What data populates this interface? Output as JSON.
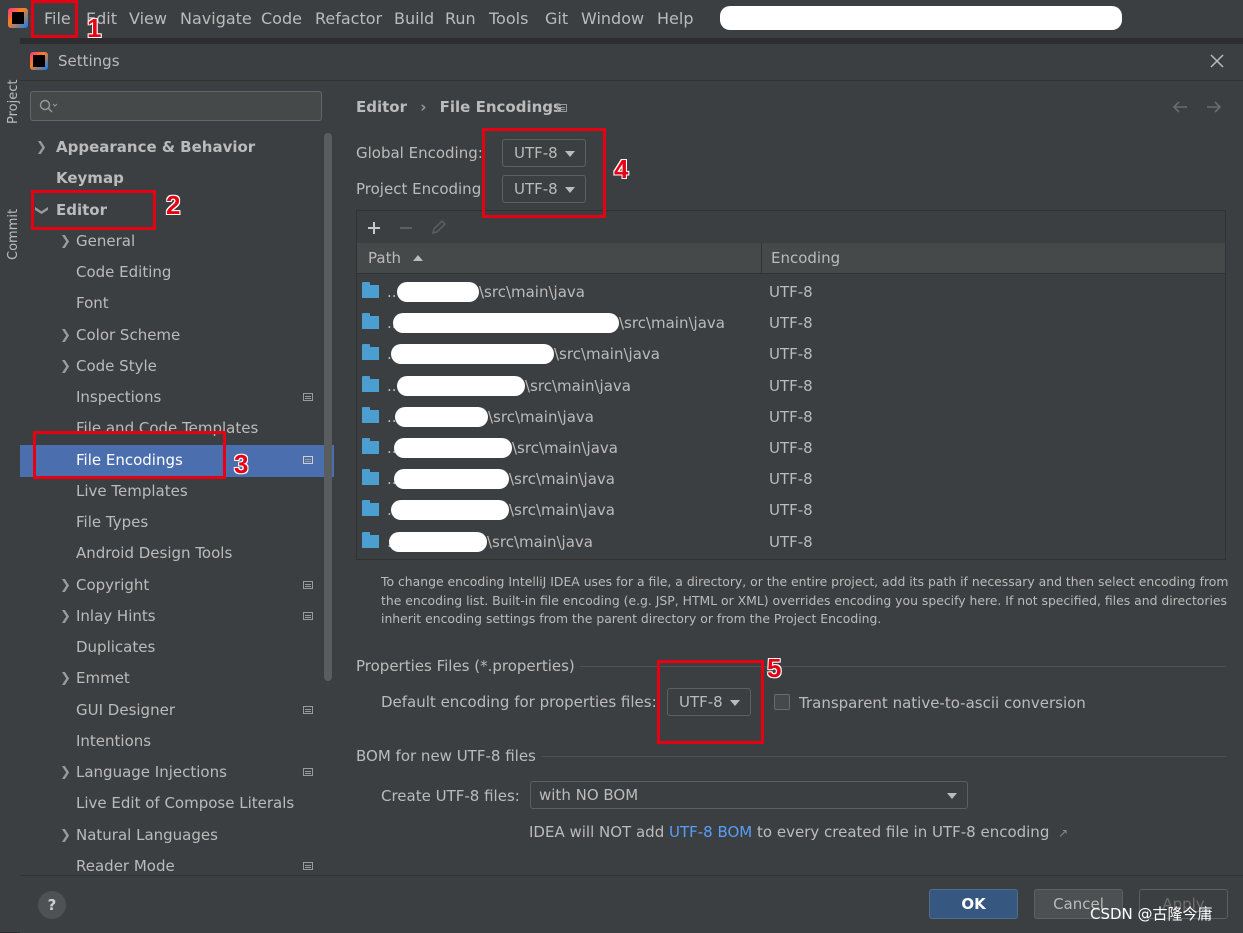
{
  "menubar": {
    "items": [
      "File",
      "Edit",
      "View",
      "Navigate",
      "Code",
      "Refactor",
      "Build",
      "Run",
      "Tools",
      "Git",
      "Window",
      "Help"
    ]
  },
  "toolstrip": {
    "project": "Project",
    "commit": "Commit"
  },
  "dialog": {
    "title": "Settings"
  },
  "sidebar": {
    "items": [
      {
        "label": "Appearance & Behavior"
      },
      {
        "label": "Keymap"
      },
      {
        "label": "Editor"
      },
      {
        "label": "General"
      },
      {
        "label": "Code Editing"
      },
      {
        "label": "Font"
      },
      {
        "label": "Color Scheme"
      },
      {
        "label": "Code Style"
      },
      {
        "label": "Inspections"
      },
      {
        "label": "File and Code Templates"
      },
      {
        "label": "File Encodings"
      },
      {
        "label": "Live Templates"
      },
      {
        "label": "File Types"
      },
      {
        "label": "Android Design Tools"
      },
      {
        "label": "Copyright"
      },
      {
        "label": "Inlay Hints"
      },
      {
        "label": "Duplicates"
      },
      {
        "label": "Emmet"
      },
      {
        "label": "GUI Designer"
      },
      {
        "label": "Intentions"
      },
      {
        "label": "Language Injections"
      },
      {
        "label": "Live Edit of Compose Literals"
      },
      {
        "label": "Natural Languages"
      },
      {
        "label": "Reader Mode"
      }
    ]
  },
  "breadcrumb": {
    "parent": "Editor",
    "sep": "›",
    "current": "File Encodings"
  },
  "encoding": {
    "global_label": "Global Encoding:",
    "global_value": "UTF-8",
    "project_label": "Project Encoding:",
    "project_value": "UTF-8"
  },
  "table": {
    "columns": [
      "Path",
      "Encoding"
    ],
    "rows": [
      {
        "prefix": "..",
        "suffix": "\\src\\main\\java",
        "encoding": "UTF-8"
      },
      {
        "prefix": "..",
        "suffix": "\\src\\main\\java",
        "encoding": "UTF-8"
      },
      {
        "prefix": "..",
        "suffix": "\\src\\main\\java",
        "encoding": "UTF-8"
      },
      {
        "prefix": "..",
        "suffix": "\\src\\main\\java",
        "encoding": "UTF-8"
      },
      {
        "prefix": "..",
        "suffix": "\\src\\main\\java",
        "encoding": "UTF-8"
      },
      {
        "prefix": "..",
        "suffix": "\\src\\main\\java",
        "encoding": "UTF-8"
      },
      {
        "prefix": "..",
        "suffix": "\\src\\main\\java",
        "encoding": "UTF-8"
      },
      {
        "prefix": "..",
        "suffix": "\\src\\main\\java",
        "encoding": "UTF-8"
      },
      {
        "prefix": "..",
        "suffix": "\\src\\main\\java",
        "encoding": "UTF-8"
      }
    ]
  },
  "info_text": [
    "To change encoding IntelliJ IDEA uses for a file, a directory, or the entire project, add its path if necessary and then select encoding from",
    "the encoding list. Built-in file encoding (e.g. JSP, HTML or XML) overrides encoding you specify here. If not specified, files and directories",
    "inherit encoding settings from the parent directory or from the Project Encoding."
  ],
  "properties": {
    "section_title": "Properties Files (*.properties)",
    "default_label": "Default encoding for properties files:",
    "default_value": "UTF-8",
    "native_label": "Transparent native-to-ascii conversion"
  },
  "bom": {
    "section_title": "BOM for new UTF-8 files",
    "create_label": "Create UTF-8 files:",
    "create_value": "with NO BOM",
    "note_pre": "IDEA will NOT add ",
    "note_link": "UTF-8 BOM",
    "note_post": " to every created file in UTF-8 encoding",
    "note_arrow": "↗"
  },
  "footer": {
    "ok": "OK",
    "cancel": "Cancel",
    "apply": "Apply",
    "help": "?"
  },
  "annotations": [
    "1",
    "2",
    "3",
    "4",
    "5"
  ],
  "watermark": "CSDN @古隆今庸",
  "colors": {
    "accent": "#4b6eaf",
    "link": "#589df6",
    "annotation": "#e60012",
    "ok_button": "#365880"
  }
}
